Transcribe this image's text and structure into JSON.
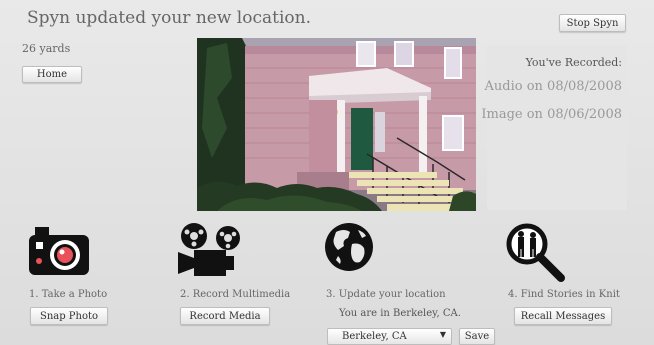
{
  "header": {
    "title": "Spyn updated your new location.",
    "distance": "26 yards",
    "home_label": "Home",
    "stop_label": "Stop Spyn"
  },
  "recorded": {
    "heading": "You've Recorded:",
    "audio": "Audio on 08/08/2008",
    "image": "Image on 08/06/2008"
  },
  "photo": {
    "icon": "house-photo"
  },
  "steps": [
    {
      "label": "1. Take a Photo",
      "button": "Snap Photo",
      "icon": "camera-icon"
    },
    {
      "label": "2. Record Multimedia",
      "button": "Record Media",
      "icon": "film-projector-icon"
    },
    {
      "label": "3. Update your location",
      "icon": "globe-icon"
    },
    {
      "label": "4. Find Stories in Knit",
      "button": "Recall Messages",
      "icon": "magnifier-icon"
    }
  ],
  "location": {
    "current_text": "You are in Berkeley, CA.",
    "selected": "Berkeley, CA",
    "save_label": "Save"
  },
  "colors": {
    "background": "#e2e2e2",
    "text": "#666666",
    "recorded_value": "#999999"
  }
}
